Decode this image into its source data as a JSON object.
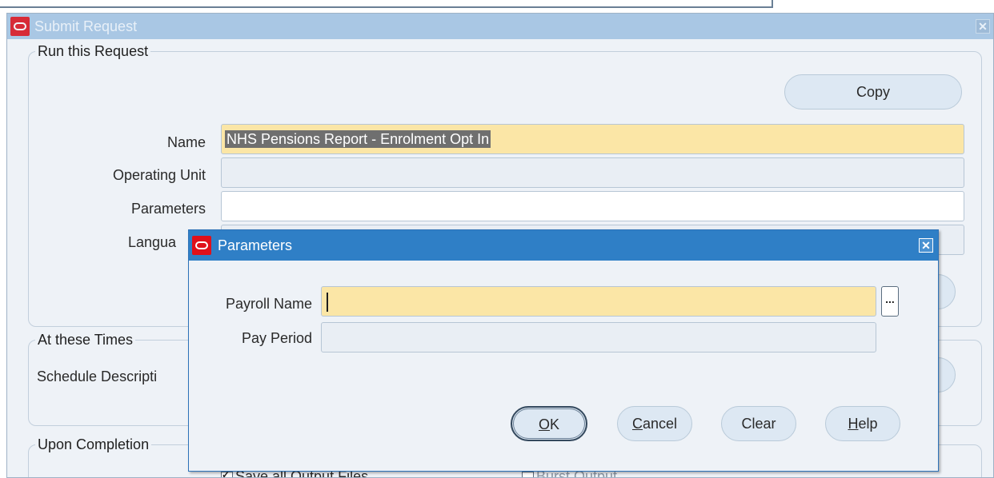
{
  "window": {
    "title": "Submit Request",
    "close": "✕"
  },
  "run": {
    "legend": "Run this Request",
    "copy_label": "Copy",
    "name_label": "Name",
    "name_value": "NHS Pensions Report - Enrolment Opt In",
    "operating_unit_label": "Operating Unit",
    "operating_unit_value": "",
    "parameters_label": "Parameters",
    "parameters_value": "",
    "language_label_visible": "Langua"
  },
  "times": {
    "legend": "At these Times",
    "schedule_label_visible": "Schedule Descripti"
  },
  "completion": {
    "legend": "Upon Completion",
    "save_output_label": "Save all Output Files",
    "burst_label": "Burst Output"
  },
  "dialog": {
    "title": "Parameters",
    "close": "✕",
    "payroll_label": "Payroll Name",
    "payroll_value": "",
    "lov_label": "...",
    "period_label": "Pay Period",
    "period_value": "",
    "ok": {
      "mnemonic": "O",
      "rest": "K"
    },
    "cancel": {
      "mnemonic": "C",
      "rest": "ancel"
    },
    "clear": "Clear",
    "help": {
      "mnemonic": "H",
      "rest": "elp"
    }
  }
}
